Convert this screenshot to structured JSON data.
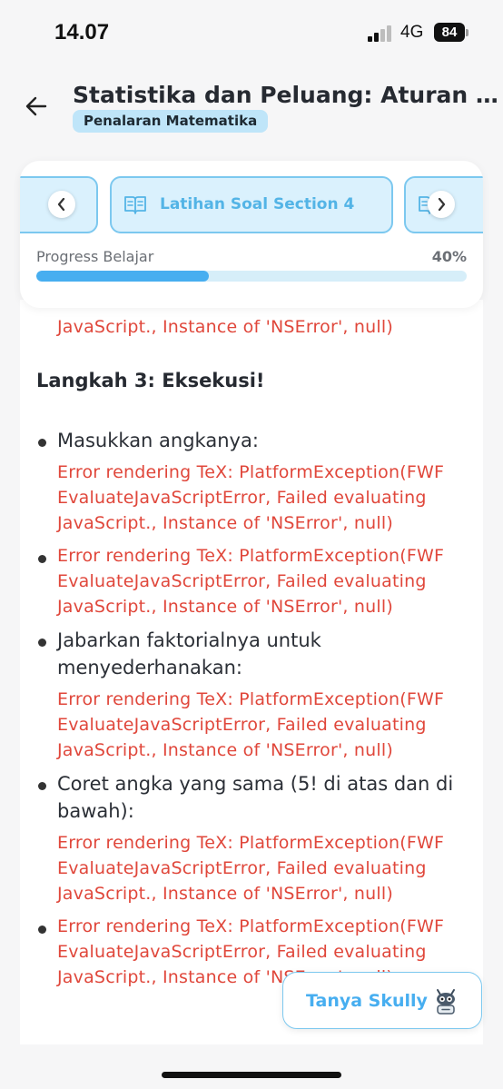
{
  "status_bar": {
    "time": "14.07",
    "network": "4G",
    "battery": "84"
  },
  "header": {
    "title": "Statistika dan Peluang: Aturan Pen...",
    "badge": "Penalaran Matematika"
  },
  "section_nav": {
    "current_section": "Latihan Soal Section 4"
  },
  "progress": {
    "label": "Progress Belajar",
    "value_text": "40%",
    "fraction": 0.4
  },
  "content": {
    "previous_error_tail": "JavaScript., Instance of 'NSError', null)",
    "step_title": "Langkah 3: Eksekusi!",
    "bullets": [
      {
        "text": "Masukkan angkanya:",
        "error": "Error rendering TeX: PlatformException(FWF EvaluateJavaScriptError, Failed evaluating JavaScript., Instance of 'NSError', null)"
      },
      {
        "text": "",
        "error": "Error rendering TeX: PlatformException(FWF EvaluateJavaScriptError, Failed evaluating JavaScript., Instance of 'NSError', null)"
      },
      {
        "text": "Jabarkan faktorialnya untuk menyederhanakan:",
        "error": "Error rendering TeX: PlatformException(FWF EvaluateJavaScriptError, Failed evaluating JavaScript., Instance of 'NSError', null)"
      },
      {
        "text": "Coret angka yang sama (5! di atas dan di bawah):",
        "error": "Error rendering TeX: PlatformException(FWF EvaluateJavaScriptError, Failed evaluating JavaScript., Instance of 'NSError', null)"
      },
      {
        "text": "",
        "error": "Error rendering TeX: PlatformException(FWF EvaluateJavaScriptError, Failed evaluating JavaScript., Instance of 'NSError', null)"
      }
    ]
  },
  "assistant": {
    "label": "Tanya Skully",
    "icon": "skully-robot-icon"
  },
  "colors": {
    "accent": "#47aef0",
    "error": "#e0473b",
    "badge_bg": "#bfe5f9"
  }
}
